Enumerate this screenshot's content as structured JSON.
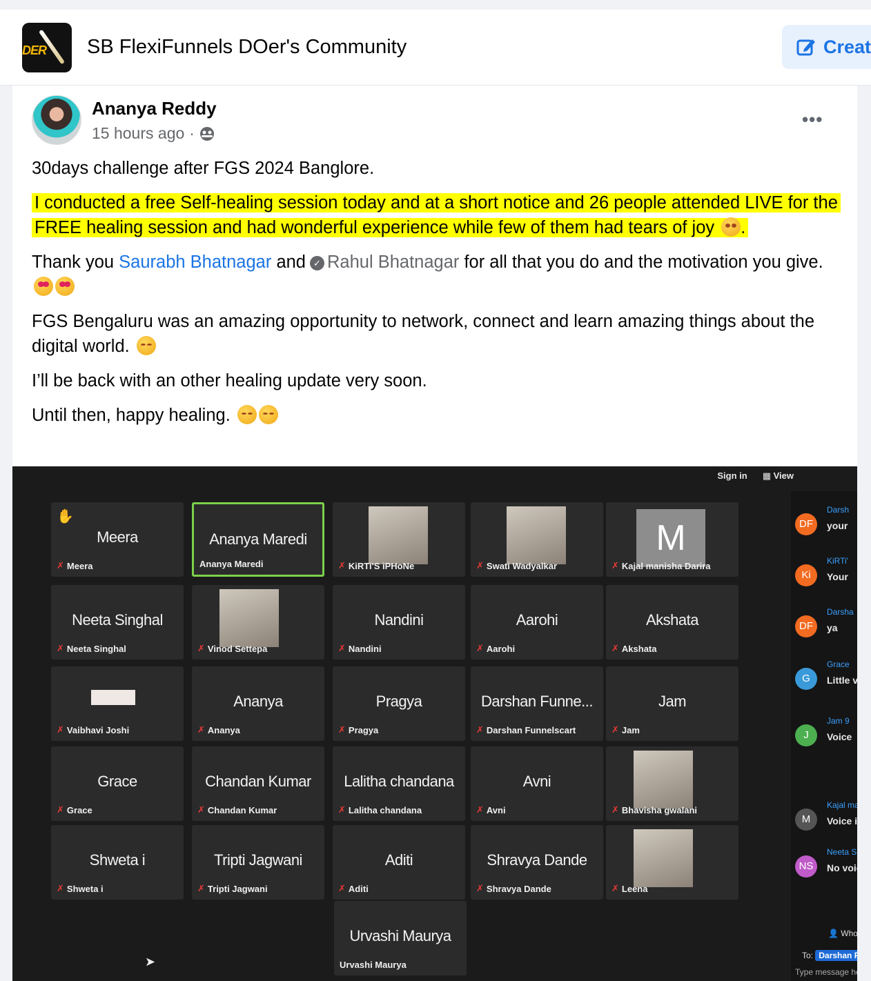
{
  "group": {
    "name": "SB FlexiFunnels DOer's Community",
    "logo_text": "DER",
    "create_label": "Creat"
  },
  "post": {
    "author": "Ananya Reddy",
    "timestamp": "15 hours ago",
    "separator": "·",
    "audience_icon": "group-audience-icon",
    "more_label": "•••",
    "line1": "30days challenge after FGS 2024 Banglore.",
    "highlight": "I conducted a free Self-healing session today and at a short notice and 26 people attended LIVE for the FREE healing session and had wonderful experience while few of them had tears of joy",
    "thanks_prefix": "Thank you",
    "mention1": "Saurabh Bhatnagar",
    "and": "and",
    "mention2": "Rahul Bhatnagar",
    "thanks_suffix": "for all that you do and the motivation you give.",
    "fgs_text": "FGS Bengaluru was an amazing opportunity to network, connect and learn amazing things about the digital world.",
    "back_text": "I’ll be back with an other healing update very soon.",
    "until_text": "Until then, happy healing.",
    "highlight_color": "#ffff00",
    "link_color": "#1b74e4"
  },
  "screenshot": {
    "sign_in": "Sign in",
    "view": "View",
    "tiles": [
      {
        "name": "Meera",
        "label": "Meera"
      },
      {
        "name": "Ananya Maredi",
        "label": "Ananya Maredi"
      },
      {
        "name": "",
        "label": "KiRTi'S iPHoNe"
      },
      {
        "name": "",
        "label": "Swati Wadyalkar"
      },
      {
        "name": "M",
        "label": "Kajal manisha Darira"
      },
      {
        "name": "Neeta Singhal",
        "label": "Neeta Singhal"
      },
      {
        "name": "",
        "label": "Vinod Settepa"
      },
      {
        "name": "Nandini",
        "label": "Nandini"
      },
      {
        "name": "Aarohi",
        "label": "Aarohi"
      },
      {
        "name": "Akshata",
        "label": "Akshata"
      },
      {
        "name": "",
        "label": "Vaibhavi Joshi"
      },
      {
        "name": "Ananya",
        "label": "Ananya"
      },
      {
        "name": "Pragya",
        "label": "Pragya"
      },
      {
        "name": "Darshan Funne...",
        "label": "Darshan Funnelscart"
      },
      {
        "name": "Jam",
        "label": "Jam"
      },
      {
        "name": "Grace",
        "label": "Grace"
      },
      {
        "name": "Chandan Kumar",
        "label": "Chandan Kumar"
      },
      {
        "name": "Lalitha chandana",
        "label": "Lalitha chandana"
      },
      {
        "name": "Avni",
        "label": "Avni"
      },
      {
        "name": "",
        "label": "Bhavisha gwalani"
      },
      {
        "name": "Shweta i",
        "label": "Shweta i"
      },
      {
        "name": "Tripti Jagwani",
        "label": "Tripti Jagwani"
      },
      {
        "name": "Aditi",
        "label": "Aditi"
      },
      {
        "name": "Shravya Dande",
        "label": "Shravya Dande"
      },
      {
        "name": "",
        "label": "Leena"
      },
      {
        "name": "Urvashi Maurya",
        "label": "Urvashi Maurya"
      }
    ],
    "chat": [
      {
        "initials": "DF",
        "name": "Darsh",
        "text": "your",
        "color": "#f26b21"
      },
      {
        "initials": "Ki",
        "name": "KiRTi'",
        "text": "Your",
        "color": "#f26b21"
      },
      {
        "initials": "DF",
        "name": "Darsha",
        "text": "ya",
        "color": "#f26b21"
      },
      {
        "initials": "G",
        "name": "Grace",
        "text": "Little voice",
        "color": "#3a9ad9"
      },
      {
        "initials": "J",
        "name": "Jam 9",
        "text": "Voice",
        "color": "#4caf50"
      },
      {
        "initials": "M",
        "name": "Kajal ma",
        "text": "Voice is",
        "color": "#555555"
      },
      {
        "initials": "NS",
        "name": "Neeta Sin",
        "text": "No voice",
        "color": "#c05bc9"
      }
    ],
    "who_can": "Who car",
    "to_label": "To:",
    "to_value": "Darshan Fun",
    "type_message": "Type message her",
    "small_text": "Ur"
  }
}
